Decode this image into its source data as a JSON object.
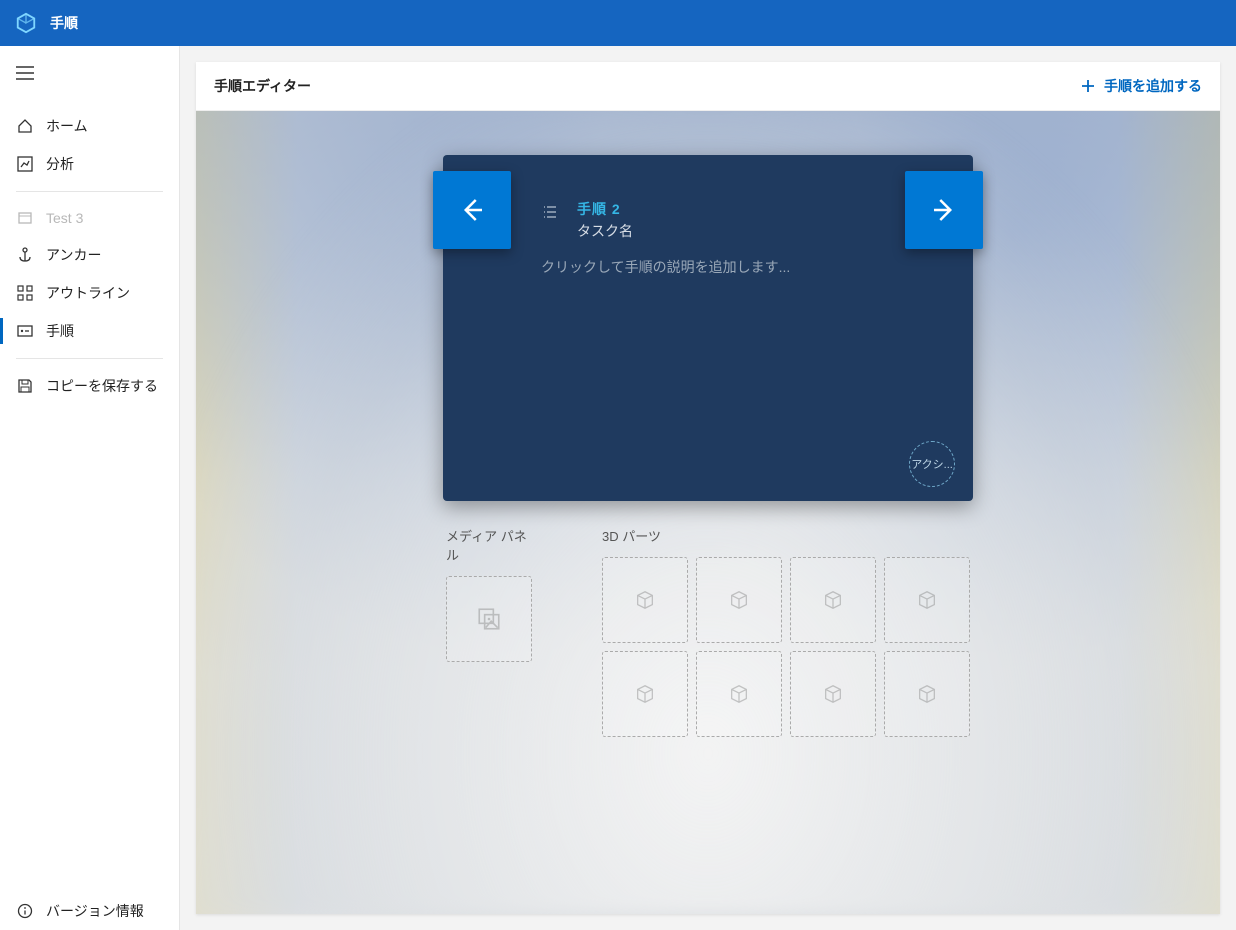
{
  "topbar": {
    "title": "手順"
  },
  "sidebar": {
    "home": "ホーム",
    "analyze": "分析",
    "guide": "Test 3",
    "anchor": "アンカー",
    "outline": "アウトライン",
    "steps": "手順",
    "save_copy": "コピーを保存する",
    "version_info": "バージョン情報"
  },
  "editor": {
    "title": "手順エディター",
    "add_step": "手順を追加する"
  },
  "step_card": {
    "step_number": "手順 2",
    "task_name": "タスク名",
    "description_placeholder": "クリックして手順の説明を追加します...",
    "action_label": "アクシ..."
  },
  "panels": {
    "media_label": "メディア パネル",
    "parts_label": "3D パーツ"
  }
}
